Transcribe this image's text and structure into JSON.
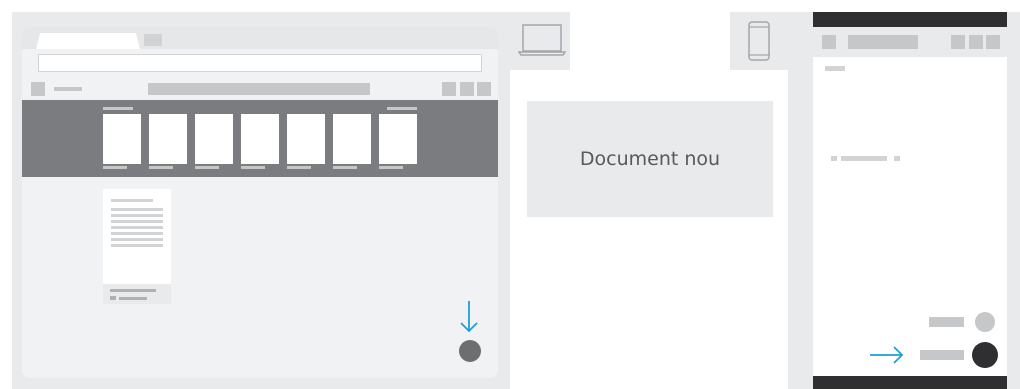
{
  "caption": "Document nou",
  "colors": {
    "panel_gray": "#e9eaec",
    "browser_bg": "#f1f2f4",
    "strip": "#7b7c7f",
    "placeholder": "#c6c7c9",
    "dark": "#2f2f31",
    "fab_dark": "#6d6e70",
    "accent_arrow": "#1ba0dc"
  },
  "icons": {
    "laptop": "laptop-icon",
    "phone": "phone-icon",
    "arrow_down": "arrow-down-icon",
    "arrow_right": "arrow-right-icon"
  },
  "desktop": {
    "recent_thumbnails": 7
  }
}
